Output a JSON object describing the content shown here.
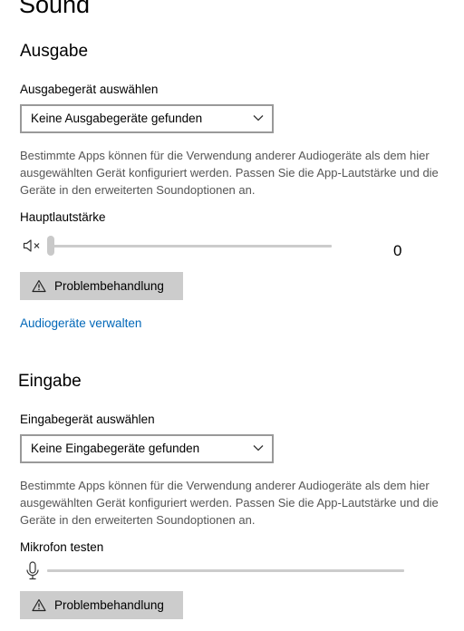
{
  "page": {
    "title": "Sound"
  },
  "output": {
    "heading": "Ausgabe",
    "device_label": "Ausgabegerät auswählen",
    "device_selected": "Keine Ausgabegeräte gefunden",
    "description": "Bestimmte Apps können für die Verwendung anderer Audiogeräte als dem hier ausgewählten Gerät konfiguriert werden. Passen Sie die App-Lautstärke und die Geräte in den erweiterten Soundoptionen an.",
    "volume_label": "Hauptlautstärke",
    "volume_value": "0",
    "volume_level": 0,
    "troubleshoot_label": "Problembehandlung",
    "manage_link": "Audiogeräte verwalten"
  },
  "input": {
    "heading": "Eingabe",
    "device_label": "Eingabegerät auswählen",
    "device_selected": "Keine Eingabegeräte gefunden",
    "description": "Bestimmte Apps können für die Verwendung anderer Audiogeräte als dem hier ausgewählten Gerät konfiguriert werden. Passen Sie die App-Lautstärke und die Geräte in den erweiterten Soundoptionen an.",
    "mic_test_label": "Mikrofon testen",
    "mic_level": 0,
    "troubleshoot_label": "Problembehandlung"
  },
  "icons": {
    "mute": "speaker-muted-icon",
    "microphone": "microphone-icon",
    "warning": "warning-triangle-icon",
    "chevron": "chevron-down-icon"
  },
  "colors": {
    "link": "#0067b8",
    "button_bg": "#cccccc",
    "slider_track": "#cccccc",
    "dropdown_border": "#999999"
  }
}
